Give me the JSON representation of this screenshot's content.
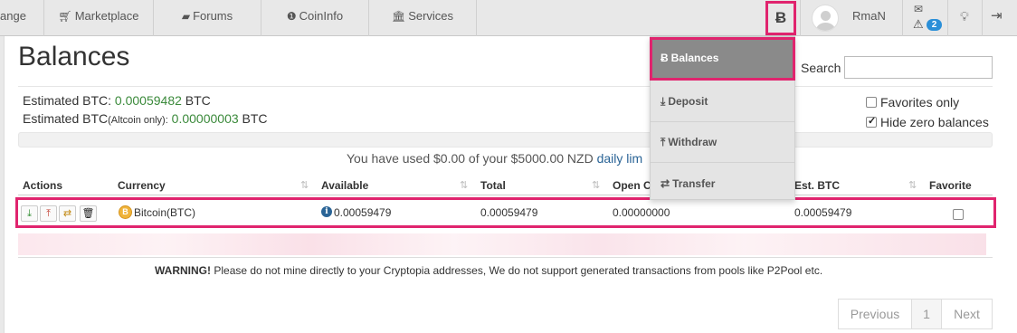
{
  "nav": {
    "items": [
      {
        "label": "ange",
        "icon": ""
      },
      {
        "label": "Marketplace",
        "icon": "cart-icon"
      },
      {
        "label": "Forums",
        "icon": "comments-icon"
      },
      {
        "label": "CoinInfo",
        "icon": "info-circle-icon"
      },
      {
        "label": "Services",
        "icon": "bank-icon"
      }
    ],
    "currency_button_label": "Ƀ",
    "username": "RmaN",
    "notification_count": "2"
  },
  "dropdown": {
    "items": [
      {
        "label": "Balances",
        "icon": "bitcoin-icon",
        "active": true
      },
      {
        "label": "Deposit",
        "icon": "download-icon",
        "active": false
      },
      {
        "label": "Withdraw",
        "icon": "upload-icon",
        "active": false
      },
      {
        "label": "Transfer",
        "icon": "exchange-icon",
        "active": false
      }
    ]
  },
  "page": {
    "title": "Balances",
    "search_label": "Search",
    "search_value": ""
  },
  "estimates": {
    "btc_label": "Estimated BTC:",
    "btc_value": "0.00059482",
    "btc_unit": "BTC",
    "altcoin_label_main": "Estimated BTC",
    "altcoin_label_small": "(Altcoin only):",
    "altcoin_value": "0.00000003",
    "altcoin_unit": "BTC"
  },
  "filters": {
    "favorites_only": {
      "label": "Favorites only",
      "checked": false
    },
    "hide_zero": {
      "label": "Hide zero balances",
      "checked": true
    }
  },
  "usage": {
    "text": "You have used $0.00 of your $5000.00 NZD",
    "link": "daily lim"
  },
  "table": {
    "headers": [
      "Actions",
      "Currency",
      "Available",
      "Total",
      "Open C",
      "Est. BTC",
      "Favorite"
    ],
    "row": {
      "currency": "Bitcoin(BTC)",
      "available": "0.00059479",
      "total": "0.00059479",
      "open_orders": "0.00000000",
      "est_btc": "0.00059479",
      "favorite": false
    }
  },
  "warning": {
    "bold": "WARNING!",
    "text": "Please do not mine directly to your Cryptopia addresses, We do not support generated transactions from pools like P2Pool etc."
  },
  "pager": {
    "previous": "Previous",
    "current": "1",
    "next": "Next"
  },
  "colors": {
    "highlight": "#e0246e",
    "green_value": "#3b8a3b",
    "link": "#2a6496",
    "badge": "#2a8fd8"
  }
}
